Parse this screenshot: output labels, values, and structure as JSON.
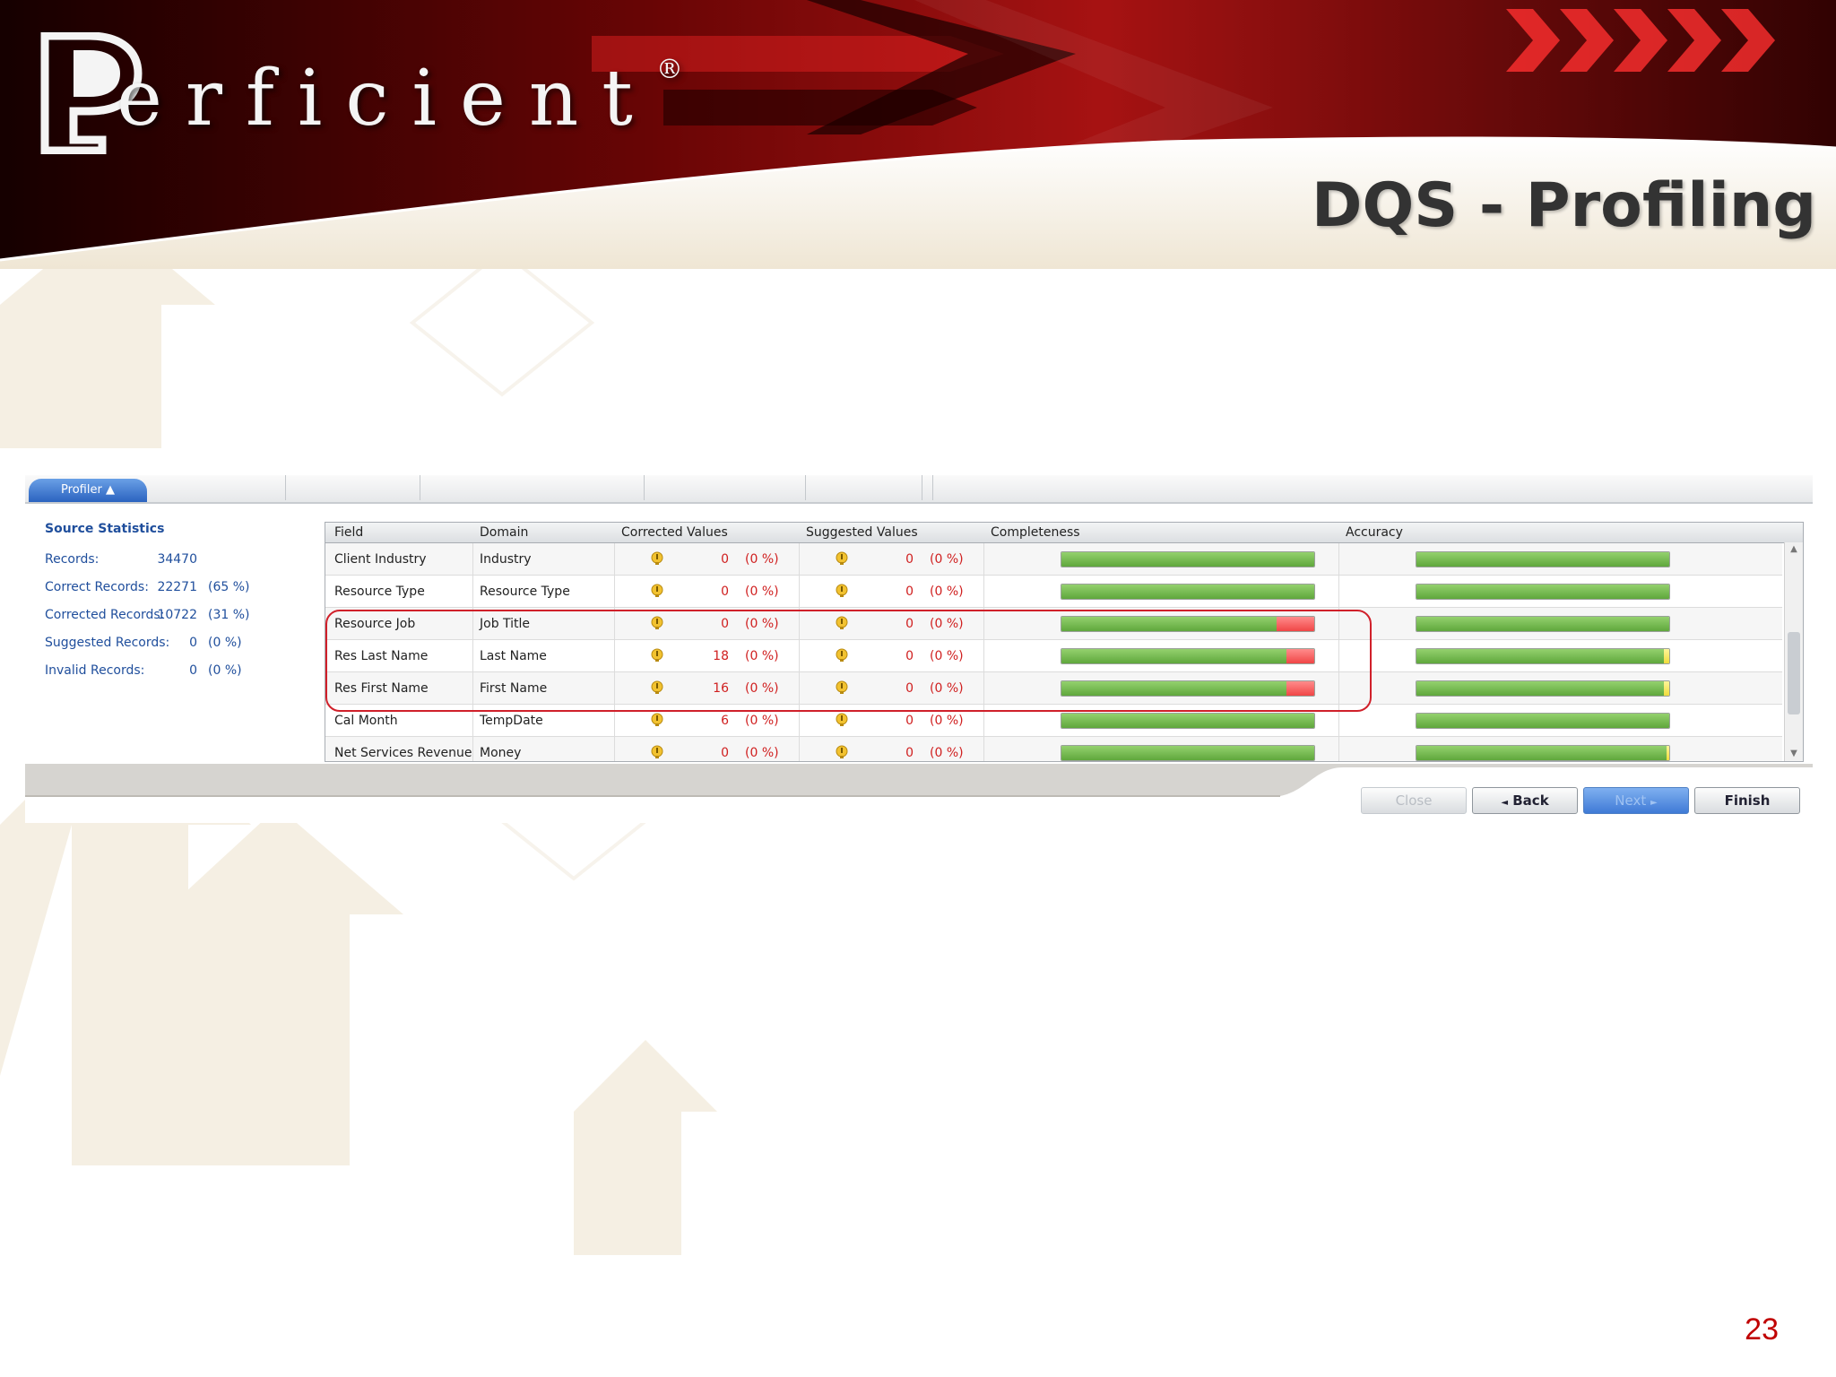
{
  "slide": {
    "logo_text": "erficient",
    "logo_reg": "®",
    "title": "DQS - Profiling",
    "page_number": "23"
  },
  "app": {
    "tab_label": "Profiler",
    "left_panel": {
      "title": "Source Statistics",
      "rows": [
        {
          "label": "Records:",
          "value": "34470",
          "pct": ""
        },
        {
          "label": "Correct Records:",
          "value": "22271",
          "pct": "(65 %)"
        },
        {
          "label": "Corrected Records:",
          "value": "10722",
          "pct": "(31 %)"
        },
        {
          "label": "Suggested Records:",
          "value": "0",
          "pct": "(0 %)"
        },
        {
          "label": "Invalid Records:",
          "value": "0",
          "pct": "(0 %)"
        }
      ]
    },
    "grid": {
      "headers": {
        "field": "Field",
        "domain": "Domain",
        "corrected": "Corrected Values",
        "suggested": "Suggested Values",
        "completeness": "Completeness",
        "accuracy": "Accuracy"
      },
      "rows": [
        {
          "field": "Client Industry",
          "domain": "Industry",
          "corrected": "0",
          "corrected_pct": "(0 %)",
          "suggested": "0",
          "suggested_pct": "(0 %)",
          "completeness": 1.0,
          "accuracy": 1.0
        },
        {
          "field": "Resource Type",
          "domain": "Resource Type",
          "corrected": "0",
          "corrected_pct": "(0 %)",
          "suggested": "0",
          "suggested_pct": "(0 %)",
          "completeness": 1.0,
          "accuracy": 1.0
        },
        {
          "field": "Resource Job",
          "domain": "Job Title",
          "corrected": "0",
          "corrected_pct": "(0 %)",
          "suggested": "0",
          "suggested_pct": "(0 %)",
          "completeness": 0.85,
          "accuracy": 1.0
        },
        {
          "field": "Res Last Name",
          "domain": "Last Name",
          "corrected": "18",
          "corrected_pct": "(0 %)",
          "suggested": "0",
          "suggested_pct": "(0 %)",
          "completeness": 0.89,
          "accuracy": 0.98
        },
        {
          "field": "Res First Name",
          "domain": "First Name",
          "corrected": "16",
          "corrected_pct": "(0 %)",
          "suggested": "0",
          "suggested_pct": "(0 %)",
          "completeness": 0.89,
          "accuracy": 0.98
        },
        {
          "field": "Cal Month",
          "domain": "TempDate",
          "corrected": "6",
          "corrected_pct": "(0 %)",
          "suggested": "0",
          "suggested_pct": "(0 %)",
          "completeness": 1.0,
          "accuracy": 1.0
        },
        {
          "field": "Net Services Revenue",
          "domain": "Money",
          "corrected": "0",
          "corrected_pct": "(0 %)",
          "suggested": "0",
          "suggested_pct": "(0 %)",
          "completeness": 1.0,
          "accuracy": 0.99
        }
      ]
    },
    "buttons": {
      "close": "Close",
      "back": "Back",
      "next": "Next",
      "finish": "Finish"
    }
  },
  "colors": {
    "banner_red": "#b01010",
    "title_gray": "#333333",
    "page_number_red": "#c00000",
    "highlight_red": "#d0202a",
    "bar_green": "#5fa73c",
    "bar_red": "#f04646",
    "bar_yellow": "#f0dc3c"
  }
}
